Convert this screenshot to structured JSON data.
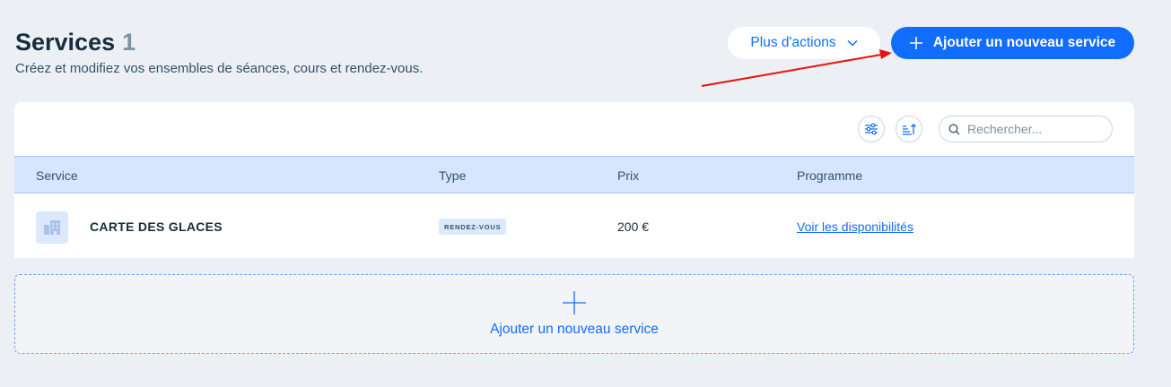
{
  "header": {
    "title": "Services",
    "count": "1",
    "subtitle": "Créez et modifiez vos ensembles de séances, cours et rendez-vous."
  },
  "actions": {
    "more_label": "Plus d'actions",
    "add_label": "Ajouter un nouveau service"
  },
  "toolbar": {
    "search_placeholder": "Rechercher..."
  },
  "table": {
    "columns": [
      "Service",
      "Type",
      "Prix",
      "Programme"
    ],
    "rows": [
      {
        "name": "CARTE DES GLACES",
        "type": "RENDEZ-VOUS",
        "price": "200 €",
        "schedule_link": "Voir les disponibilités"
      }
    ]
  },
  "add_area": {
    "label": "Ajouter un nouveau service"
  },
  "colors": {
    "accent": "#116dff",
    "background": "#eceff4",
    "header_row": "#d6e6fe",
    "annotation_arrow": "#e8120c"
  }
}
